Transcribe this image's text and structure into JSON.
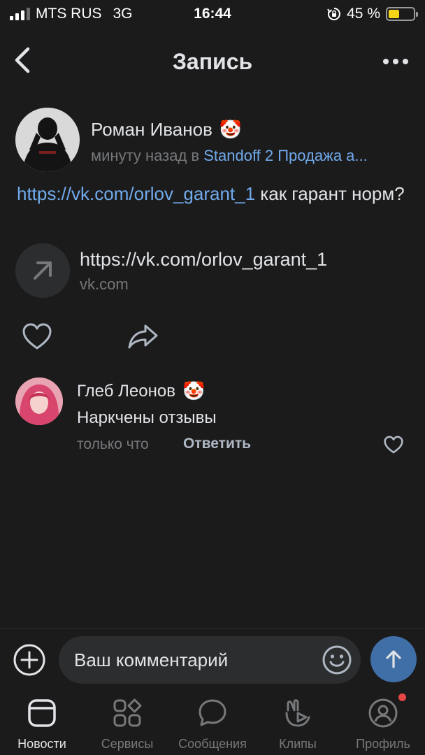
{
  "status_bar": {
    "carrier": "MTS RUS",
    "network": "3G",
    "time": "16:44",
    "battery_percent": "45 %",
    "battery_level": 0.45
  },
  "header": {
    "title": "Запись"
  },
  "post": {
    "author": "Роман Иванов",
    "author_emoji": "🤡",
    "time": "минуту назад в",
    "group": "Standoff 2 Продажа а...",
    "text_link": "https://vk.com/orlov_garant_1",
    "text_rest": "как гарант норм?",
    "attachment": {
      "url": "https://vk.com/orlov_garant_1",
      "domain": "vk.com"
    }
  },
  "comment": {
    "author": "Глеб Леонов",
    "author_emoji": "🤡",
    "text": "Наркчены отзывы",
    "time": "только что",
    "reply_label": "Ответить"
  },
  "composer": {
    "placeholder": "Ваш комментарий"
  },
  "tabs": [
    {
      "label": "Новости",
      "icon": "news-icon",
      "active": true
    },
    {
      "label": "Сервисы",
      "icon": "services-icon",
      "active": false
    },
    {
      "label": "Сообщения",
      "icon": "messages-icon",
      "active": false
    },
    {
      "label": "Клипы",
      "icon": "clips-icon",
      "active": false
    },
    {
      "label": "Профиль",
      "icon": "profile-icon",
      "active": false
    }
  ],
  "colors": {
    "background": "#1b1b1c",
    "link": "#71aaeb",
    "secondary_text": "#76787a",
    "send_button": "#3f6fa6",
    "battery": "#f5d515",
    "notification": "#e64646"
  }
}
